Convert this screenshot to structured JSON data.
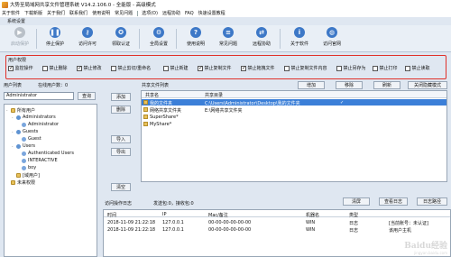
{
  "window": {
    "title": "大势至局域网共享文件管理系统 V14.2.106.0 - 全能版 - 高级模式"
  },
  "menu": {
    "left": [
      "关于软件",
      "下载新版",
      "关于我们",
      "联系我们",
      "使用说明",
      "常见问题"
    ],
    "right": [
      "选项(O)",
      "远程协助",
      "FAQ",
      "快速设置教程"
    ]
  },
  "settings_label": "系统设置",
  "toolbar": {
    "buttons": [
      {
        "label": "启动保护",
        "icon": "play-icon",
        "color": "#b9c0c8",
        "disabled": true
      },
      {
        "label": "停止保护",
        "icon": "pause-icon",
        "color": "#3d78c7"
      },
      {
        "label": "访问许可",
        "icon": "key-icon",
        "color": "#3d78c7"
      },
      {
        "label": "领取认证",
        "icon": "badge-icon",
        "color": "#3d78c7"
      },
      {
        "label": "全局设置",
        "icon": "gear-icon",
        "color": "#3d78c7"
      },
      {
        "label": "使用说明",
        "icon": "help-icon",
        "color": "#3d78c7"
      },
      {
        "label": "常见问题",
        "icon": "question-icon",
        "color": "#3d78c7"
      },
      {
        "label": "远程协助",
        "icon": "remote-icon",
        "color": "#3d78c7"
      },
      {
        "label": "关于软件",
        "icon": "info-icon",
        "color": "#3d78c7"
      },
      {
        "label": "访问官网",
        "icon": "globe-icon",
        "color": "#3d78c7"
      }
    ]
  },
  "permissions": {
    "title": "用户权限",
    "items": [
      {
        "label": "监控操作",
        "checked": true
      },
      {
        "label": "禁止删除",
        "checked": false
      },
      {
        "label": "禁止修改",
        "checked": true
      },
      {
        "label": "禁止剪切/重命名",
        "checked": false
      },
      {
        "label": "禁止新建",
        "checked": false
      },
      {
        "label": "禁止复制文件",
        "checked": true
      },
      {
        "label": "禁止拖拽文件",
        "checked": true
      },
      {
        "label": "禁止复制文件内容",
        "checked": false
      },
      {
        "label": "禁止另存为",
        "checked": false
      },
      {
        "label": "禁止打印",
        "checked": false
      },
      {
        "label": "禁止读取",
        "checked": false
      }
    ]
  },
  "users": {
    "title": "用户列表",
    "online_label": "在线用户数：0",
    "search_value": "Administrator",
    "search_button": "查询",
    "tree": [
      {
        "label": "所有用户",
        "level": 0,
        "type": "folder",
        "toggle": "-"
      },
      {
        "label": "Administrators",
        "level": 1,
        "type": "group",
        "toggle": "-"
      },
      {
        "label": "Administrator",
        "level": 2,
        "type": "user",
        "toggle": ""
      },
      {
        "label": "Guests",
        "level": 1,
        "type": "group",
        "toggle": "-"
      },
      {
        "label": "Guest",
        "level": 2,
        "type": "user",
        "toggle": ""
      },
      {
        "label": "Users",
        "level": 1,
        "type": "group",
        "toggle": "-"
      },
      {
        "label": "Authenticated Users",
        "level": 2,
        "type": "user",
        "toggle": ""
      },
      {
        "label": "INTERACTIVE",
        "level": 2,
        "type": "user",
        "toggle": ""
      },
      {
        "label": "boy",
        "level": 2,
        "type": "user",
        "toggle": ""
      },
      {
        "label": "[域用户]",
        "level": 1,
        "type": "folder",
        "toggle": ""
      },
      {
        "label": "未来权限",
        "level": 0,
        "type": "folder",
        "toggle": ""
      }
    ]
  },
  "middle_buttons": [
    "添加",
    "删除",
    "导入",
    "导出",
    "清空"
  ],
  "shares": {
    "title": "共享文件列表",
    "buttons": [
      "增加",
      "移除",
      "刷新",
      "关闭隐藏模式"
    ],
    "columns": [
      "共享名",
      "共享目录"
    ],
    "rows": [
      {
        "name": "我的文件夹",
        "path": "C:\\Users\\Administrator\\Desktop\\我的文件夹",
        "selected": true,
        "mark": "✓"
      },
      {
        "name": "网络共享文件夹",
        "path": "E:\\网络共享文件夹",
        "selected": false,
        "mark": ""
      },
      {
        "name": "SuperShare*",
        "path": "",
        "selected": false,
        "mark": ""
      },
      {
        "name": "MyShare*",
        "path": "",
        "selected": false,
        "mark": ""
      }
    ]
  },
  "log": {
    "title": "访问操作日志",
    "count": "发送包:0，接收包:0",
    "buttons": [
      "清屏",
      "查看日志",
      "日志路径"
    ],
    "columns": [
      "时间",
      "IP",
      "Mac/备注",
      "机器名",
      "类型"
    ],
    "rows": [
      {
        "time": "2018-11-09 21:22:18",
        "ip": "127.0.0.1",
        "mac": "00-00-00-00-00-00",
        "host": "WIN",
        "type": "日志",
        "extra": "[当前账号：未认证]"
      },
      {
        "time": "2018-11-09 21:22:18",
        "ip": "127.0.0.1",
        "mac": "00-00-00-00-00-00",
        "host": "WIN",
        "type": "日志",
        "extra": "该用户主机"
      }
    ]
  },
  "watermark": {
    "line1": "Baidu经验",
    "line2": "jingyan.baidu.com"
  }
}
